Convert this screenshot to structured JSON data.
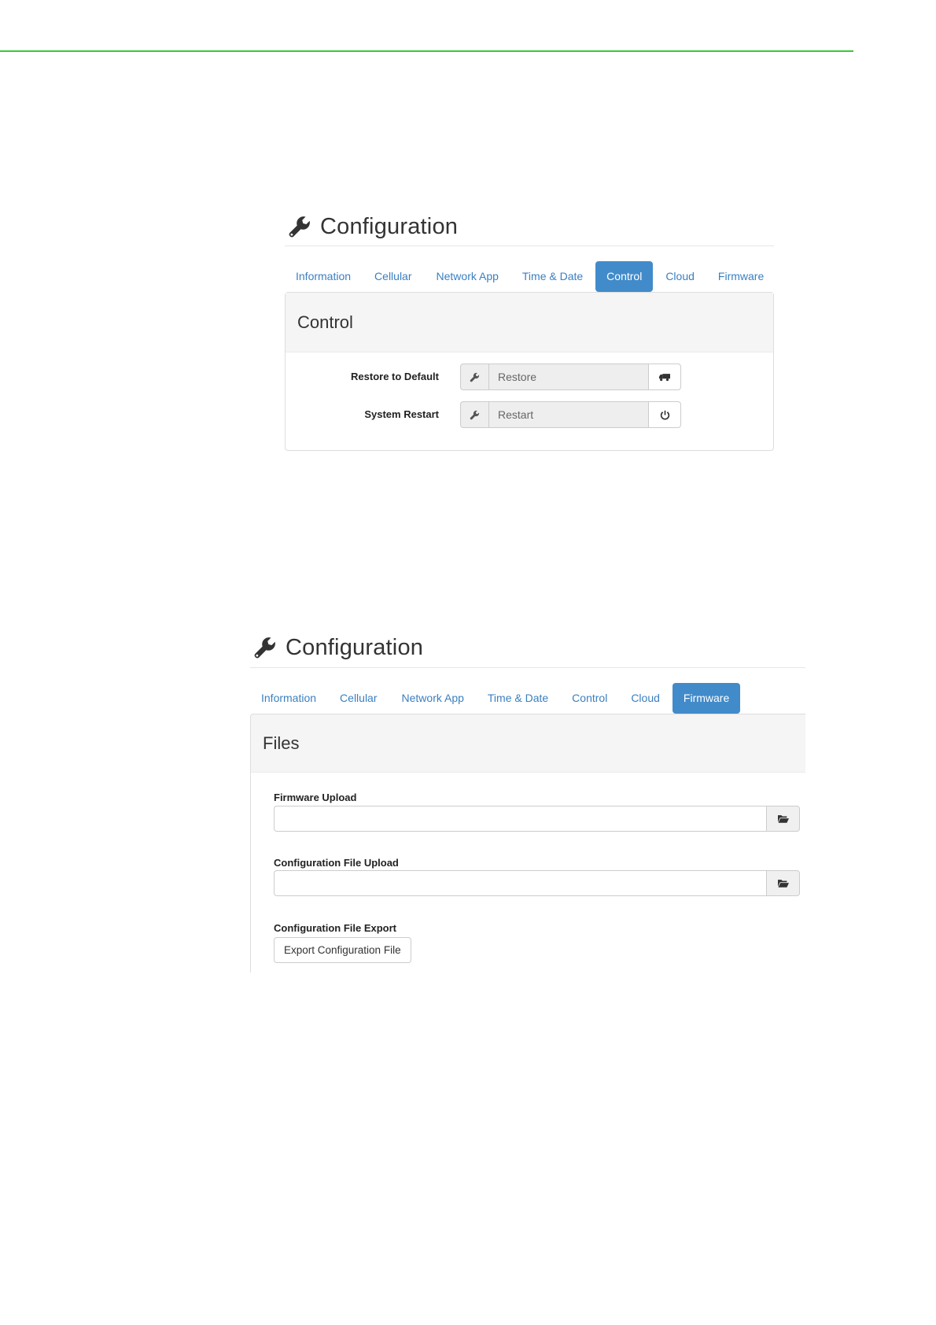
{
  "colors": {
    "top_rule": "#33cc33",
    "accent": "#428bca",
    "tab_link": "#3a7fc0"
  },
  "control_screen": {
    "header": {
      "icon": "wrench-icon",
      "title": "Configuration"
    },
    "tabs": [
      {
        "label": "Information",
        "active": false
      },
      {
        "label": "Cellular",
        "active": false
      },
      {
        "label": "Network App",
        "active": false
      },
      {
        "label": "Time & Date",
        "active": false
      },
      {
        "label": "Control",
        "active": true
      },
      {
        "label": "Cloud",
        "active": false
      },
      {
        "label": "Firmware",
        "active": false
      }
    ],
    "panel": {
      "heading": "Control",
      "rows": [
        {
          "label": "Restore to Default",
          "field_value": "Restore",
          "addon_icon": "wrench-icon",
          "button_icon": "truck-icon"
        },
        {
          "label": "System Restart",
          "field_value": "Restart",
          "addon_icon": "wrench-icon",
          "button_icon": "power-icon"
        }
      ]
    }
  },
  "firmware_screen": {
    "header": {
      "icon": "wrench-icon",
      "title": "Configuration"
    },
    "tabs": [
      {
        "label": "Information",
        "active": false
      },
      {
        "label": "Cellular",
        "active": false
      },
      {
        "label": "Network App",
        "active": false
      },
      {
        "label": "Time & Date",
        "active": false
      },
      {
        "label": "Control",
        "active": false
      },
      {
        "label": "Cloud",
        "active": false
      },
      {
        "label": "Firmware",
        "active": true
      }
    ],
    "panel": {
      "heading": "Files",
      "firmware_upload_label": "Firmware Upload",
      "firmware_upload_value": "",
      "config_upload_label": "Configuration File Upload",
      "config_upload_value": "",
      "export_label": "Configuration File Export",
      "export_button": "Export Configuration File",
      "browse_icon": "folder-open-icon"
    }
  }
}
